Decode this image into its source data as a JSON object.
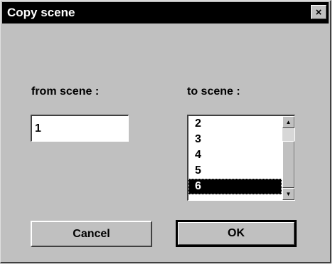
{
  "dialog": {
    "title": "Copy scene",
    "close_label": "×"
  },
  "from": {
    "label": "from scene :",
    "value": "1"
  },
  "to": {
    "label": "to scene :",
    "items": [
      "2",
      "3",
      "4",
      "5",
      "6"
    ],
    "selected": "6"
  },
  "scrollbar": {
    "up_arrow": "▲",
    "down_arrow": "▼"
  },
  "buttons": {
    "cancel": "Cancel",
    "ok": "OK"
  },
  "colors": {
    "face": "#c0c0c0",
    "titlebar": "#000000",
    "selection": "#000000"
  }
}
